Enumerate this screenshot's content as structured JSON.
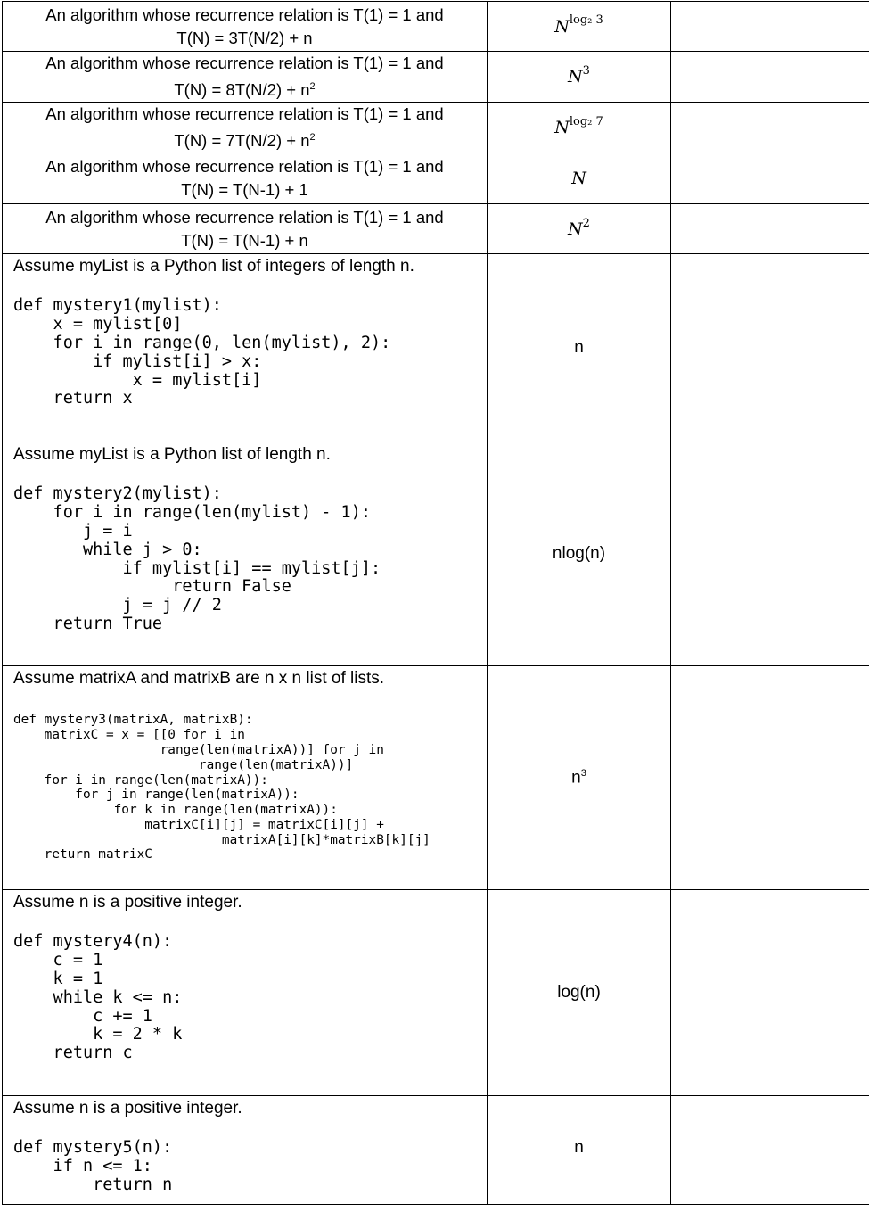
{
  "rows": [
    {
      "line1": "An algorithm whose recurrence relation is T(1) = 1 and",
      "line2": "T(N) = 3T(N/2) + n",
      "sup2": "",
      "answer_base": "N",
      "answer_exp": "log₂ 3"
    },
    {
      "line1": "An algorithm whose recurrence relation is T(1) = 1 and",
      "line2": "T(N) = 8T(N/2) + n",
      "sup2": "2",
      "answer_base": "N",
      "answer_exp": "3"
    },
    {
      "line1": "An algorithm whose recurrence relation is T(1) = 1 and",
      "line2": "T(N) = 7T(N/2) + n",
      "sup2": "2",
      "answer_base": "N",
      "answer_exp": "log₂ 7"
    },
    {
      "line1": "An algorithm whose recurrence relation is T(1) = 1 and",
      "line2": "T(N) = T(N-1) + 1",
      "sup2": "",
      "answer_base": "N",
      "answer_exp": ""
    },
    {
      "line1": "An algorithm whose recurrence relation is T(1) = 1 and",
      "line2": "T(N) = T(N-1) + n",
      "sup2": "",
      "answer_base": "N",
      "answer_exp": "2"
    }
  ],
  "code_rows": [
    {
      "intro": "Assume myList is a Python list of integers of length n.",
      "code": "def mystery1(mylist):\n    x = mylist[0]\n    for i in range(0, len(mylist), 2):\n        if mylist[i] > x:\n            x = mylist[i]\n    return x",
      "answer": "n"
    },
    {
      "intro": "Assume myList is a Python list of length n.",
      "code": "def mystery2(mylist):\n    for i in range(len(mylist) - 1):\n       j = i\n       while j > 0:\n           if mylist[i] == mylist[j]:\n                return False\n           j = j // 2\n    return True",
      "answer": "nlog(n)"
    },
    {
      "intro": "Assume matrixA and matrixB are n x n list of lists.",
      "code": "def mystery3(matrixA, matrixB):\n    matrixC = x = [[0 for i in\n                   range(len(matrixA))] for j in\n                        range(len(matrixA))]\n    for i in range(len(matrixA)):\n        for j in range(len(matrixA)):\n             for k in range(len(matrixA)):\n                 matrixC[i][j] = matrixC[i][j] +\n                           matrixA[i][k]*matrixB[k][j]\n    return matrixC",
      "answer": "n",
      "answer_sup": "3"
    },
    {
      "intro": "Assume n is a positive integer.",
      "code": "def mystery4(n):\n    c = 1\n    k = 1\n    while k <= n:\n        c += 1\n        k = 2 * k\n    return c",
      "answer": "log(n)"
    },
    {
      "intro": "Assume n is a positive integer.",
      "code": "def mystery5(n):\n    if n <= 1:\n        return n",
      "answer": "n"
    }
  ]
}
